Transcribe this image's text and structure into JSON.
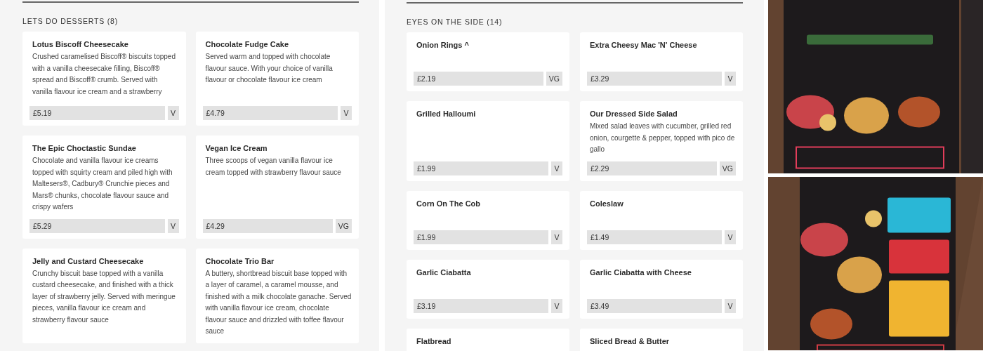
{
  "sections": [
    {
      "title": "LETS DO DESSERTS (8)",
      "items": [
        {
          "name": "Lotus Biscoff Cheesecake",
          "description": "Crushed caramelised Biscoff® biscuits topped with a vanilla cheesecake filling, Biscoff® spread and Biscoff® crumb. Served with vanilla flavour ice cream and a strawberry",
          "price": "£5.19",
          "diet": "V"
        },
        {
          "name": "Chocolate Fudge Cake",
          "description": "Served warm and topped with chocolate flavour sauce. With your choice of vanilla flavour or chocolate flavour ice cream",
          "price": "£4.79",
          "diet": "V"
        },
        {
          "name": "The Epic Choctastic Sundae",
          "description": "Chocolate and vanilla flavour ice creams topped with squirty cream and piled high with Maltesers®, Cadbury® Crunchie pieces and Mars® chunks, chocolate flavour sauce and crispy wafers",
          "price": "£5.29",
          "diet": "V"
        },
        {
          "name": "Vegan Ice Cream",
          "description": "Three scoops of vegan vanilla flavour ice cream topped with strawberry flavour sauce",
          "price": "£4.29",
          "diet": "VG"
        },
        {
          "name": "Jelly and Custard Cheesecake",
          "description": "Crunchy biscuit base topped with a vanilla custard cheesecake, and finished with a thick layer of strawberry jelly. Served with meringue pieces, vanilla flavour ice cream and strawberry flavour sauce"
        },
        {
          "name": "Chocolate Trio Bar",
          "description": "A buttery, shortbread biscuit base topped with a layer of caramel, a caramel mousse, and finished with a milk chocolate ganache. Served with vanilla flavour ice cream, chocolate flavour sauce and drizzled with toffee flavour sauce"
        }
      ]
    },
    {
      "title": "EYES ON THE SIDE (14)",
      "items": [
        {
          "name": "Onion Rings ^",
          "price": "£2.19",
          "diet": "VG"
        },
        {
          "name": "Extra Cheesy Mac 'N' Cheese",
          "price": "£3.29",
          "diet": "V"
        },
        {
          "name": "Grilled Halloumi",
          "price": "£1.99",
          "diet": "V"
        },
        {
          "name": "Our Dressed Side Salad",
          "description": "Mixed salad leaves with cucumber, grilled red onion, courgette & pepper, topped with pico de gallo",
          "price": "£2.29",
          "diet": "VG"
        },
        {
          "name": "Corn On The Cob",
          "price": "£1.99",
          "diet": "V"
        },
        {
          "name": "Coleslaw",
          "price": "£1.49",
          "diet": "V"
        },
        {
          "name": "Garlic Ciabatta",
          "price": "£3.19",
          "diet": "V"
        },
        {
          "name": "Garlic Ciabatta with Cheese",
          "price": "£3.49",
          "diet": "V"
        },
        {
          "name": "Flatbread"
        },
        {
          "name": "Sliced Bread & Butter"
        }
      ]
    }
  ]
}
